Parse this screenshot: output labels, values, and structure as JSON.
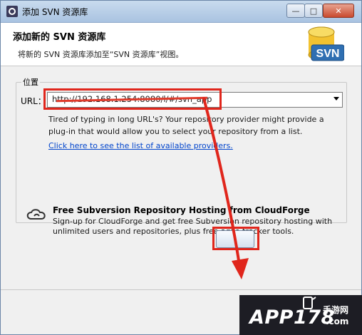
{
  "window": {
    "title": "添加 SVN 资源库"
  },
  "header": {
    "title": "添加新的 SVN 资源库",
    "description": "将新的 SVN 资源库添加至“SVN 资源库”视图。",
    "logo_text": "SVN"
  },
  "location": {
    "group_title": "位置",
    "url_label": "URL：",
    "url_value": "http://192.168.1.254:8080/l/#/svn_app",
    "hint": "Tired of typing in long URL's?  Your repository provider might provide a plug-in that would allow you to select your repository from a list.",
    "link_text": "Click here to see the list of available providers."
  },
  "cloudforge": {
    "title": "Free Subversion Repository Hosting from CloudForge",
    "body": "Sign-up for CloudForge and get free Subversion repository hosting with unlimited users and repositories, plus free agile tracker tools."
  },
  "watermark": {
    "main": "APP178",
    "side": "手游网",
    "domain": ".com"
  },
  "colors": {
    "annotation_red": "#e0261c",
    "link_blue": "#0044cc",
    "title_bar": "#a9c3e1"
  }
}
